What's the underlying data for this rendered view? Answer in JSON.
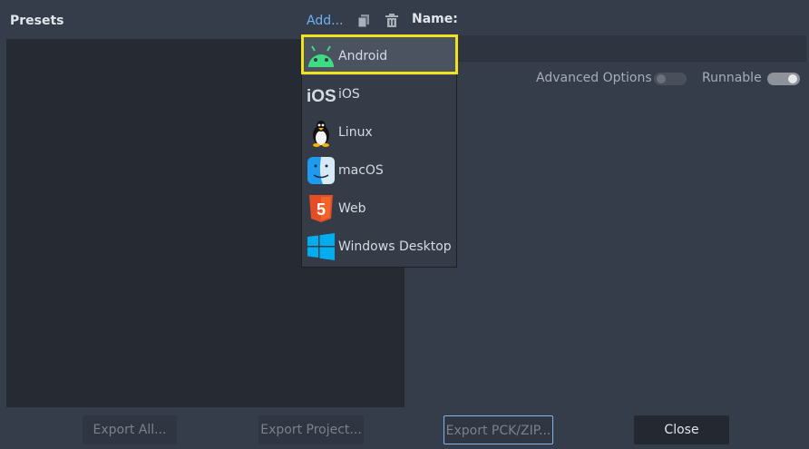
{
  "header": {
    "presets_title": "Presets",
    "add_label": "Add...",
    "name_label": "Name:"
  },
  "options": {
    "advanced_label": "Advanced Options",
    "advanced_on": false,
    "runnable_label": "Runnable",
    "runnable_on": true
  },
  "buttons": {
    "export_all": "Export All...",
    "export_project": "Export Project...",
    "export_pck": "Export PCK/ZIP...",
    "close": "Close"
  },
  "add_menu": {
    "items": [
      {
        "label": "Android",
        "icon": "android-icon",
        "hovered": true
      },
      {
        "label": "iOS",
        "icon": "ios-icon",
        "icon_text": "iOS"
      },
      {
        "label": "Linux",
        "icon": "linux-tux-icon"
      },
      {
        "label": "macOS",
        "icon": "macos-finder-icon"
      },
      {
        "label": "Web",
        "icon": "html5-icon",
        "icon_text": "5"
      },
      {
        "label": "Windows Desktop",
        "icon": "windows-icon"
      }
    ]
  },
  "colors": {
    "background": "#363d4a",
    "accent": "#6fb1f2",
    "highlight": "#f0e21c"
  }
}
